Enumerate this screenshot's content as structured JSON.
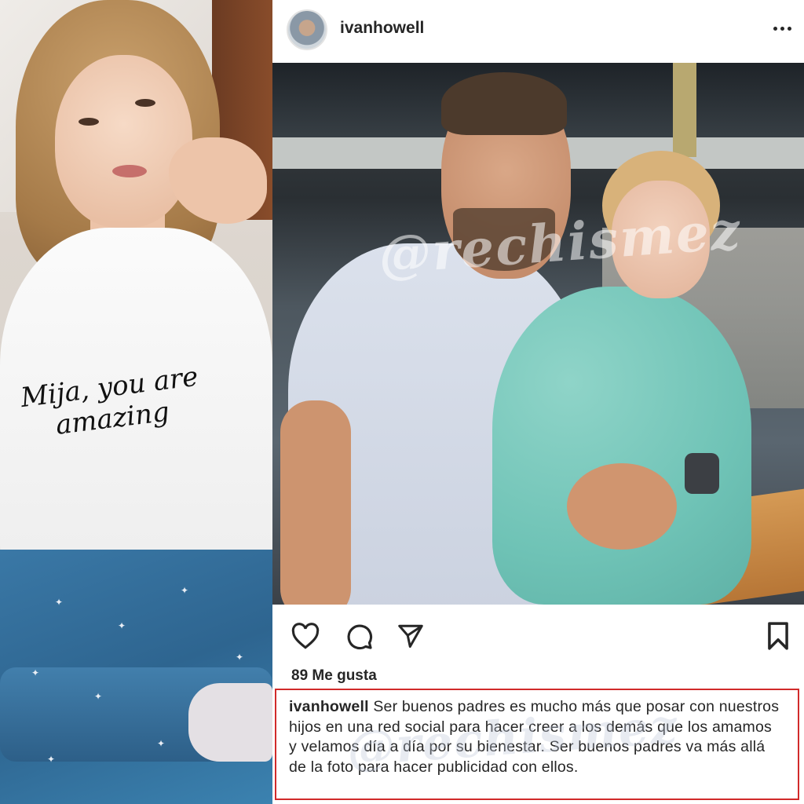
{
  "left_photo": {
    "shirt_text_line1": "Mija, you are",
    "shirt_text_line2": "amazing"
  },
  "post": {
    "username": "ivanhowell",
    "more_icon": "more-horizontal-icon",
    "watermark_photo": "@rechismez",
    "watermark_caption": "@rechismez",
    "actions": {
      "like_icon": "heart-icon",
      "comment_icon": "comment-icon",
      "share_icon": "send-icon",
      "save_icon": "bookmark-icon"
    },
    "likes_text": "89 Me gusta",
    "caption": {
      "username": "ivanhowell",
      "text": "Ser buenos padres es mucho más que posar con nuestros hijos en una red social para hacer creer a los demás que los amamos y velamos día a día por su bienestar. Ser buenos padres va más allá de la foto para hacer publicidad con ellos."
    },
    "highlight_color": "#d12a2a"
  }
}
